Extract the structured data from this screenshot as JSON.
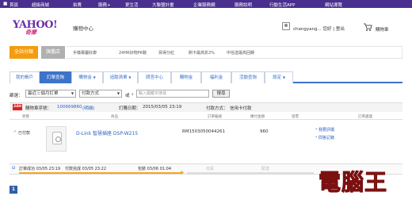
{
  "top_nav": {
    "items": [
      "首頁",
      "超級商城",
      "拍賣",
      "服務+",
      "更生活",
      "大聯盟計畫",
      "企業服務網",
      "服務說明",
      "行動生活APP",
      "網站導覽"
    ]
  },
  "header": {
    "logo_main": "YAHOO!",
    "logo_sub": "奇摩",
    "site_name": "購物中心",
    "username": "changyang...",
    "welcome": "您好",
    "logout": "登出",
    "cart_label": "購物車"
  },
  "promo": {
    "btn_all": "全站分類",
    "btn_flagship": "旗艦店",
    "links": [
      "手機專屬好康",
      "24HR好物PK戰",
      "買得分紅",
      "刷卡最高折2%",
      "中信送最高回饋"
    ]
  },
  "tabs": {
    "items": [
      {
        "label": "我的帳戶",
        "caret": false
      },
      {
        "label": "訂單查詢",
        "caret": false,
        "active": true
      },
      {
        "label": "購物金",
        "caret": true
      },
      {
        "label": "追蹤清單",
        "caret": true
      },
      {
        "label": "問答中心",
        "caret": false
      },
      {
        "label": "購物金",
        "caret": false
      },
      {
        "label": "福利金",
        "caret": false
      },
      {
        "label": "活動查詢",
        "caret": false
      },
      {
        "label": "設定",
        "caret": true
      }
    ]
  },
  "filter": {
    "label": "篩選：",
    "select1": "最近三個月訂單",
    "select2": "付款方式",
    "search_mode": "或",
    "search_placeholder": "輸入關鍵字搜尋",
    "search_button": "搜尋"
  },
  "order": {
    "badge": "24H",
    "order_no_label": "購物車序號：",
    "order_no": "100669860",
    "order_detail_link": "(明細)",
    "order_date_label": "訂購日期：",
    "order_date": "2015/03/05 23:19",
    "payment_label": "付款方式：",
    "payment_method": "信用卡付款"
  },
  "table": {
    "headers": [
      "狀態",
      "商品",
      "訂單編號",
      "應付金額",
      "發票",
      "訂單處理"
    ],
    "row": {
      "status": "已付款",
      "product": "D-Link 智慧插座 DSP-W215",
      "order_id": "RM1503050044261",
      "amount": "960",
      "actions": [
        "我要評價",
        "問答記錄"
      ]
    }
  },
  "timeline": {
    "items": [
      {
        "label": "訂單成功",
        "time": "03/05 23:19",
        "done": true
      },
      {
        "label": "付款完成",
        "time": "03/05 23:22",
        "done": true
      },
      {
        "label": "包裝",
        "time": "03/06 01:04",
        "done": true
      },
      {
        "label": "出貨",
        "time": "",
        "done": false
      },
      {
        "label": "配送",
        "time": "",
        "done": false
      }
    ]
  },
  "pagination": {
    "current": "1"
  },
  "watermark": {
    "text": "電腦王"
  }
}
